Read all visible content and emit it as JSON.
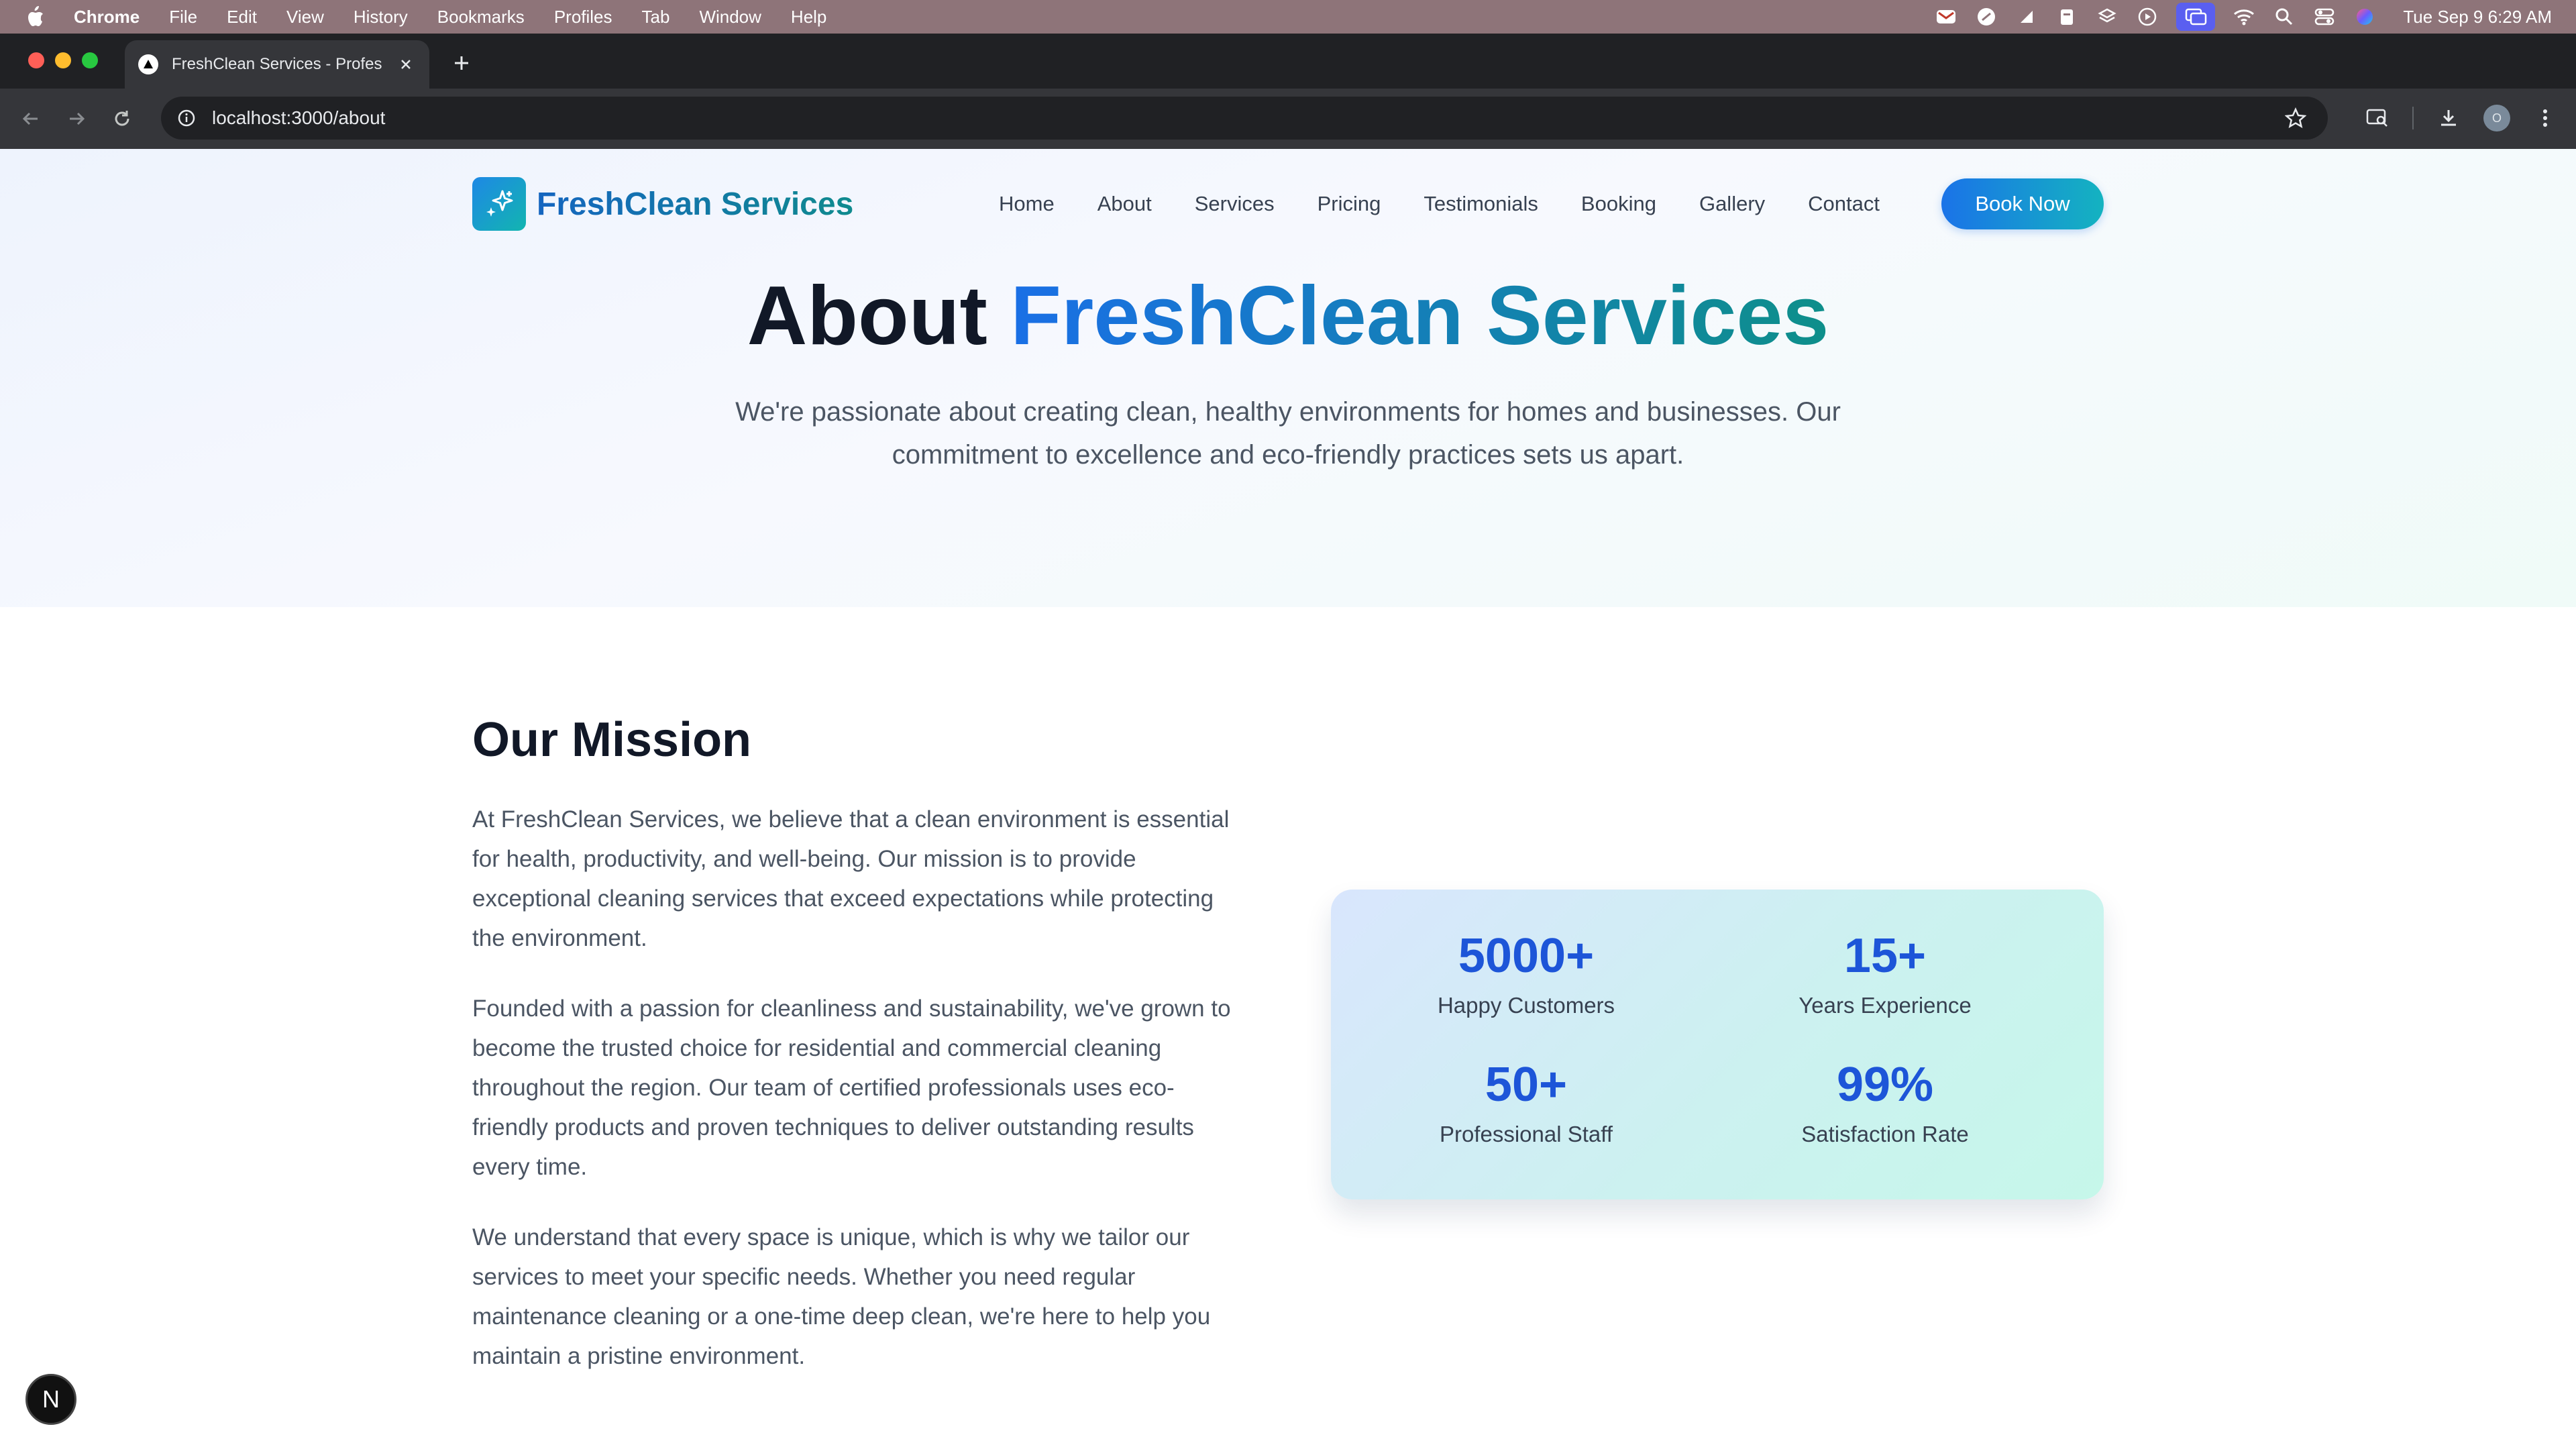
{
  "menubar": {
    "app_name": "Chrome",
    "items": [
      "File",
      "Edit",
      "View",
      "History",
      "Bookmarks",
      "Profiles",
      "Tab",
      "Window",
      "Help"
    ],
    "clock": "Tue Sep 9  6:29 AM"
  },
  "browser": {
    "tab_title": "FreshClean Services - Profes",
    "url": "localhost:3000/about",
    "profile_initial": "O"
  },
  "site": {
    "logo_text": "FreshClean Services",
    "nav": [
      "Home",
      "About",
      "Services",
      "Pricing",
      "Testimonials",
      "Booking",
      "Gallery",
      "Contact"
    ],
    "cta": "Book Now"
  },
  "hero": {
    "title_prefix": "About",
    "title_highlight": "FreshClean Services",
    "subtitle": "We're passionate about creating clean, healthy environments for homes and businesses. Our commitment to excellence and eco-friendly practices sets us apart."
  },
  "mission": {
    "title": "Our Mission",
    "paragraphs": [
      "At FreshClean Services, we believe that a clean environment is essential for health, productivity, and well-being. Our mission is to provide exceptional cleaning services that exceed expectations while protecting the environment.",
      "Founded with a passion for cleanliness and sustainability, we've grown to become the trusted choice for residential and commercial cleaning throughout the region. Our team of certified professionals uses eco-friendly products and proven techniques to deliver outstanding results every time.",
      "We understand that every space is unique, which is why we tailor our services to meet your specific needs. Whether you need regular maintenance cleaning or a one-time deep clean, we're here to help you maintain a pristine environment."
    ]
  },
  "stats": [
    {
      "value": "5000+",
      "label": "Happy Customers"
    },
    {
      "value": "15+",
      "label": "Years Experience"
    },
    {
      "value": "50+",
      "label": "Professional Staff"
    },
    {
      "value": "99%",
      "label": "Satisfaction Rate"
    }
  ],
  "dev_badge": "N",
  "colors": {
    "menubar_bg": "#8e7479",
    "accent_blue": "#1a73e8",
    "accent_teal": "#14b3c0",
    "stat_number": "#1d55d8"
  }
}
